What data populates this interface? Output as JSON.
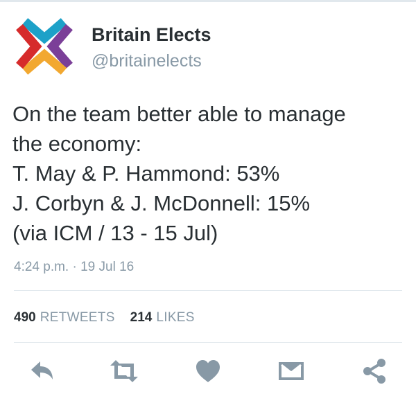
{
  "tweet": {
    "author": {
      "display_name": "Britain Elects",
      "handle": "@britainelects",
      "logo_icon": "britain-elects-logo",
      "logo_colors": [
        "#1da1c8",
        "#7b3f98",
        "#f2a830",
        "#d62b2b"
      ]
    },
    "text_lines": [
      "On the team better able to manage",
      "the economy:",
      "T. May & P. Hammond: 53%",
      "J. Corbyn & J. McDonnell: 15%",
      "(via ICM / 13 - 15 Jul)"
    ],
    "timestamp": "4:24 p.m. · 19 Jul 16",
    "stats": {
      "retweets_count": "490",
      "retweets_label": "Retweets",
      "likes_count": "214",
      "likes_label": "Likes"
    },
    "actions": {
      "icons": [
        "reply-icon",
        "retweet-icon",
        "like-icon",
        "direct-message-icon",
        "share-icon"
      ],
      "icon_color": "#8899a6"
    }
  }
}
